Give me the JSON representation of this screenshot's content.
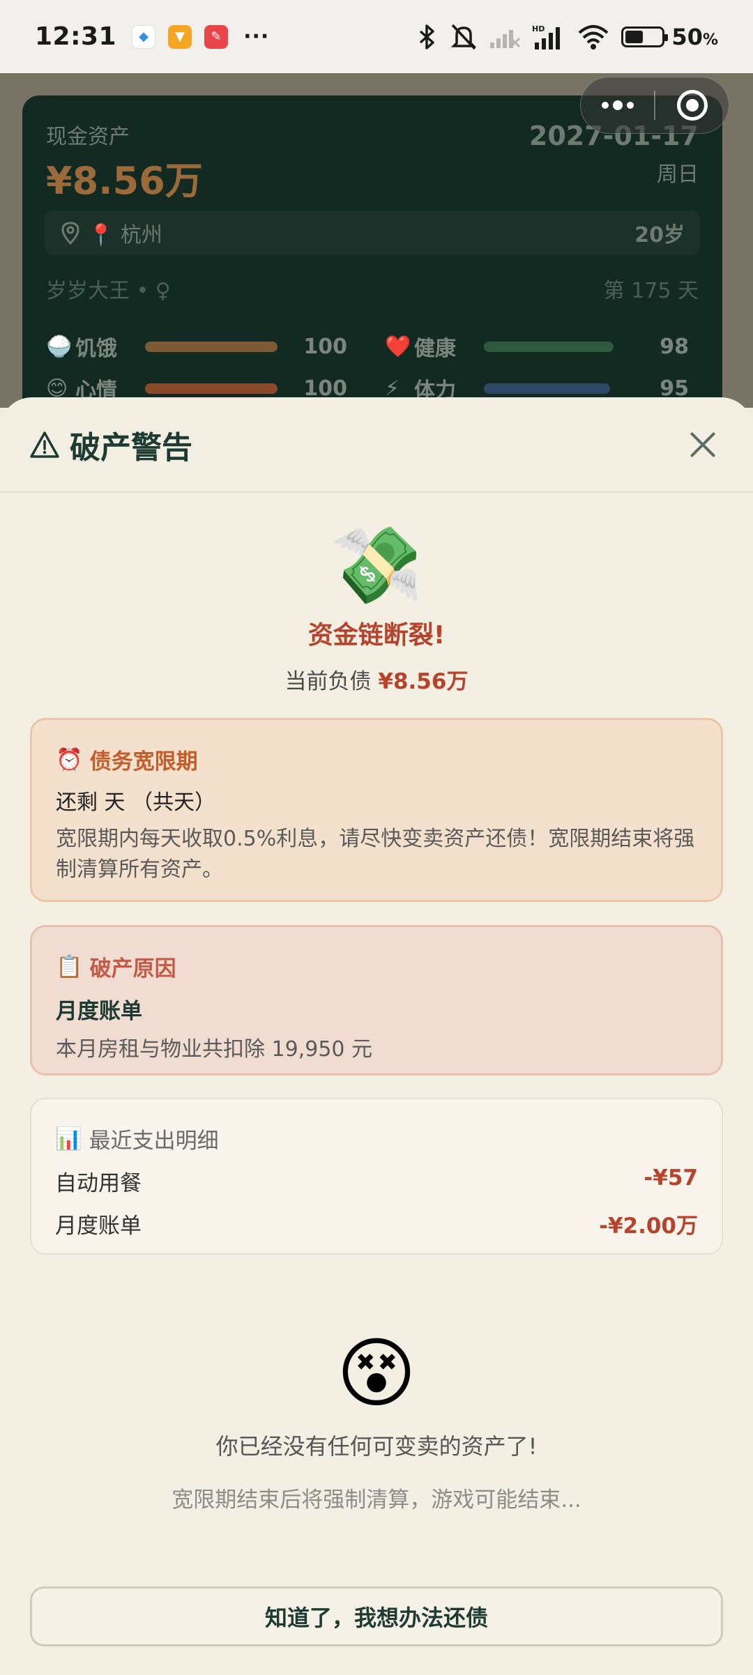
{
  "status_bar": {
    "time": "12:31",
    "more": "···",
    "battery": "50",
    "battery_unit": "%"
  },
  "asset_card": {
    "label": "现金资产",
    "amount": "¥8.56万",
    "date": "2027-01-17",
    "weekday": "周日",
    "location": "📍 杭州",
    "age": "20岁",
    "player": "岁岁大王 • ♀",
    "day": "第 175 天",
    "stats": [
      {
        "icon": "🍚",
        "name": "饥饿",
        "value": "100",
        "level": 1.0,
        "color": "#7b5a35"
      },
      {
        "icon": "❤️",
        "name": "健康",
        "value": "98",
        "level": 0.98,
        "color": "#2d5a3a"
      },
      {
        "icon": "😊",
        "name": "心情",
        "value": "100",
        "level": 1.0,
        "color": "#8a4a2a"
      },
      {
        "icon": "⚡",
        "name": "体力",
        "value": "95",
        "level": 0.95,
        "color": "#2e4866"
      }
    ]
  },
  "sheet": {
    "title": "破产警告",
    "hero_emoji": "💸",
    "hero_title": "资金链断裂!",
    "debt_label": "当前负债",
    "debt_amount": "¥8.56万",
    "grace": {
      "icon": "⏰",
      "title": "债务宽限期",
      "line": "还剩 天 （共天）",
      "desc": "宽限期内每天收取0.5%利息，请尽快变卖资产还债！宽限期结束将强制清算所有资产。"
    },
    "reason": {
      "icon": "📋",
      "title": "破产原因",
      "name": "月度账单",
      "desc": "本月房租与物业共扣除 19,950 元"
    },
    "recent": {
      "icon": "📊",
      "title": "最近支出明细",
      "items": [
        {
          "label": "自动用餐",
          "amount": "-¥57"
        },
        {
          "label": "月度账单",
          "amount": "-¥2.00万"
        }
      ]
    },
    "face_emoji": "😵",
    "no_asset": "你已经没有任何可变卖的资产了!",
    "warn_end": "宽限期结束后将强制清算，游戏可能结束...",
    "ok_button": "知道了，我想办法还债"
  }
}
